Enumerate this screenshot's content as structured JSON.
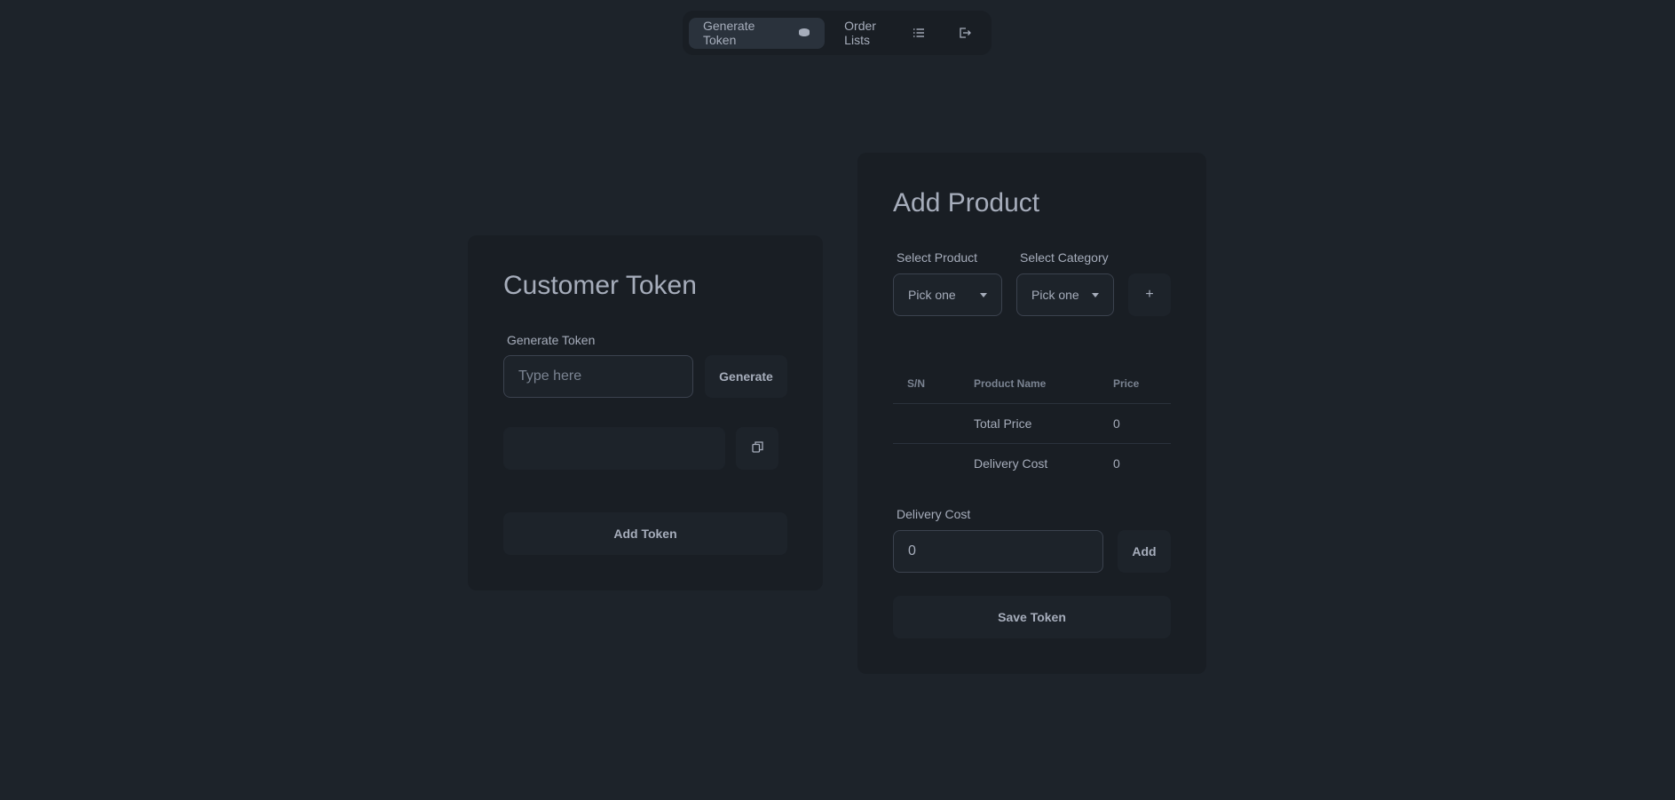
{
  "nav": {
    "items": [
      {
        "label": "Generate Token",
        "icon": "coins-icon"
      },
      {
        "label": "Order Lists",
        "icon": "list-icon"
      }
    ],
    "logout_icon": "logout-icon"
  },
  "customer_token": {
    "title": "Customer Token",
    "generate_label": "Generate Token",
    "input_placeholder": "Type here",
    "generate_button": "Generate",
    "token_value": "",
    "add_token_button": "Add Token"
  },
  "add_product": {
    "title": "Add Product",
    "select_product_label": "Select Product",
    "select_product_value": "Pick one",
    "select_category_label": "Select Category",
    "select_category_value": "Pick one",
    "add_button": "+",
    "table": {
      "headers": [
        "S/N",
        "Product Name",
        "Price"
      ],
      "rows": [
        [
          "",
          "Total Price",
          "0"
        ],
        [
          "",
          "Delivery Cost",
          "0"
        ]
      ]
    },
    "delivery_cost_label": "Delivery Cost",
    "delivery_cost_value": "0",
    "delivery_add_button": "Add",
    "save_button": "Save Token"
  },
  "colors": {
    "background": "#1d232a",
    "card": "#191e24",
    "text": "#a6adbb"
  }
}
